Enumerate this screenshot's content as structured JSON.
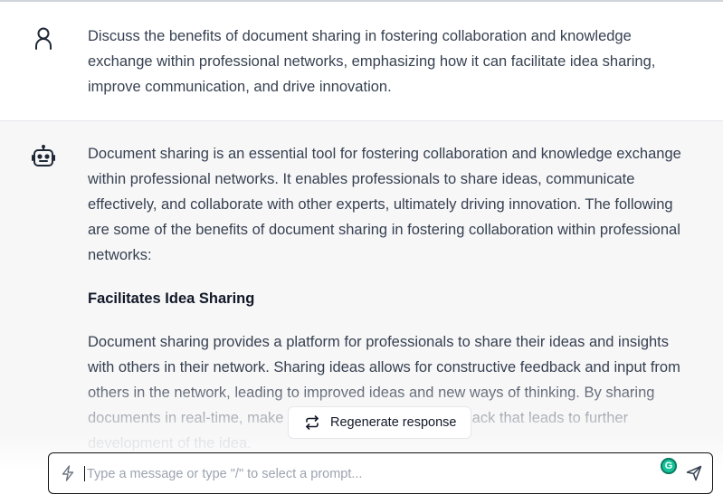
{
  "conversation": {
    "user_message": {
      "avatar_icon": "user-icon",
      "text": "Discuss the benefits of document sharing in fostering collaboration and knowledge exchange within professional networks, emphasizing how it can facilitate idea sharing, improve communication, and drive innovation."
    },
    "assistant_message": {
      "avatar_icon": "robot-icon",
      "intro": "Document sharing is an essential tool for fostering collaboration and knowledge exchange within professional networks. It enables professionals to share ideas, communicate effectively, and collaborate with other experts, ultimately driving innovation. The following are some of the benefits of document sharing in fostering collaboration within professional networks:",
      "heading": "Facilitates Idea Sharing",
      "paragraph": "Document sharing provides a platform for professionals to share their ideas and insights with others in their network. Sharing ideas allows for constructive feedback and input from others in the network, leading to improved ideas and new ways of thinking. By sharing documents in real-time, make changes, and provide feedback that leads to further development of the idea."
    }
  },
  "regenerate": {
    "label": "Regenerate response",
    "icon": "refresh-icon"
  },
  "composer": {
    "placeholder": "Type a message or type \"/\" to select a prompt...",
    "value": "",
    "left_icon": "lightning-icon",
    "extension_icon": "grammarly-icon",
    "extension_letter": "G",
    "send_icon": "send-icon"
  },
  "colors": {
    "assistant_bg": "#f7f7f8",
    "text": "#374151",
    "grammarly": "#15c39a"
  }
}
